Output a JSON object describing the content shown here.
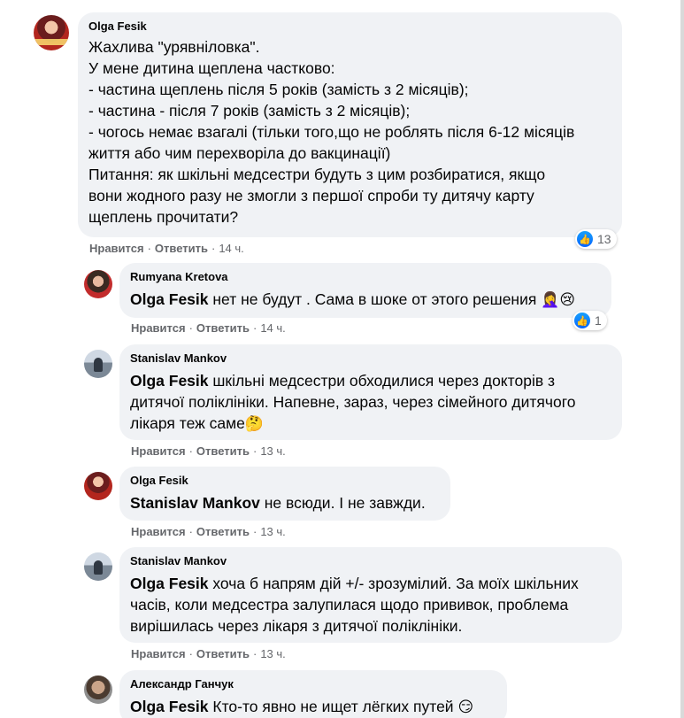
{
  "comments": [
    {
      "author": "Olga Fesik",
      "text": "Жахлива \"урявніловка\".\nУ мене дитина щеплена частково:\n- частина щеплень після 5 років (замість з 2 місяців);\n- частина - після 7 років (замість з 2 місяців);\n- чогось немає взагалі (тільки того,що не роблять після 6-12 місяців\nжиття або чим перехворіла до вакцинації)\nПитання: як шкільні медсестри будуть з цим розбиратися, якщо\nвони жодного разу не змогли з першої спроби ту дитячу карту\nщеплень прочитати?",
      "like": "Нравится",
      "reply": "Ответить",
      "time": "14 ч.",
      "reactions": "13"
    },
    {
      "author": "Rumyana Kretova",
      "mention": "Olga Fesik",
      "text": " нет не будут . Сама в шоке от этого решения ",
      "emoji": "🤦‍♀️😢",
      "like": "Нравится",
      "reply": "Ответить",
      "time": "14 ч.",
      "reactions": "1"
    },
    {
      "author": "Stanislav Mankov",
      "mention": "Olga Fesik",
      "text": " шкільні медсестри обходилися через докторів з\nдитячої поліклініки. Напевне, зараз, через сімейного дитячого\nлікаря теж саме",
      "emoji": "🤔",
      "like": "Нравится",
      "reply": "Ответить",
      "time": "13 ч."
    },
    {
      "author": "Olga Fesik",
      "mention": "Stanislav Mankov",
      "text": " не всюди. І не завжди.",
      "like": "Нравится",
      "reply": "Ответить",
      "time": "13 ч."
    },
    {
      "author": "Stanislav Mankov",
      "mention": "Olga Fesik",
      "text": " хоча б напрям дій +/- зрозумілий. За моїх шкільних\nчасів, коли медсестра залупилася щодо прививок, проблема\nвирішилась через лікаря з дитячої поліклініки.",
      "like": "Нравится",
      "reply": "Ответить",
      "time": "13 ч."
    },
    {
      "author": "Александр Ганчук",
      "mention": "Olga Fesik",
      "text": " Кто-то явно не ищет лёгких путей ",
      "emoji": "😏"
    }
  ],
  "separator": "·",
  "icons": {
    "like": "like-icon"
  },
  "colors": {
    "bubble": "#f0f2f5",
    "muted": "#65676b",
    "like_blue": "#0866ff"
  }
}
